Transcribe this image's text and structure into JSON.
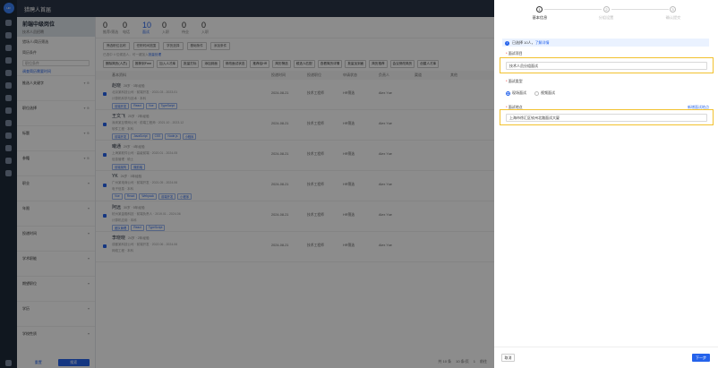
{
  "app": {
    "title": "猎聘人首届"
  },
  "sidebar": {
    "project_name": "前端中级岗位",
    "project_sub": "技术人员招聘",
    "header_label": "猎场人/简历筛选",
    "field1_label": "简历条件",
    "field1_value": "职位条件",
    "link1": "调查简历需要时间",
    "filters": [
      "推选人关键字",
      "职位选择",
      "标题",
      "参籍",
      "职业",
      "年限",
      "投递时间",
      "学术职能",
      "期望职位",
      "学历",
      "学校性质"
    ],
    "reset": "重置",
    "search": "搜索"
  },
  "stages": [
    {
      "num": "0",
      "label": "推荐/筛选"
    },
    {
      "num": "0",
      "label": "电话"
    },
    {
      "num": "10",
      "label": "面试"
    },
    {
      "num": "0",
      "label": "入职"
    },
    {
      "num": "0",
      "label": "待业"
    },
    {
      "num": "0",
      "label": "入职"
    }
  ],
  "filters": [
    "筛选职位名称",
    "任职时间范围",
    "学历选择",
    "基础条件",
    "添加条件"
  ],
  "info": {
    "text": "已选中 4 位候选人，可一键加入",
    "link": "批量处理"
  },
  "actions": [
    "删除简历(人员)",
    "推荐到Free",
    "加入人才库",
    "批量打标",
    "添加到面",
    "修改面试状态",
    "推荐给HR",
    "简历筛选",
    "候选人匹配",
    "查看简历详情",
    "批量加到面",
    "简历推荐",
    "会议修改简历",
    "创建人才库"
  ],
  "table_head": [
    "基本资料",
    "投递时间",
    "投递职位",
    "申请状态",
    "负责人",
    "渠道",
    "其他"
  ],
  "candidates": [
    {
      "name": "赵晓",
      "meta": "28岁 · 3年经验",
      "line1": "北京某科技公司 · 前端开发 · 2021.03 - 2023.01",
      "line2": "计算机科学与技术 · 本科",
      "tags": [
        "前端开发",
        "React",
        "Vue",
        "TypeScript"
      ],
      "date": "2024-08-21",
      "job": "技术工程师",
      "status": "HR筛选",
      "owner": "Alex Yue"
    },
    {
      "name": "王文飞",
      "meta": "25岁 · 2年经验",
      "line1": "深圳某互联网公司 · 前端工程师 · 2021.10 - 2023.12",
      "line2": "软件工程 · 本科",
      "tags": [
        "前端开发",
        "JavaScript",
        "CSS",
        "Node.js",
        "小程序"
      ],
      "date": "2024-08-21",
      "job": "技术工程师",
      "status": "HR筛选",
      "owner": "Alex Yue"
    },
    {
      "name": "曦通",
      "meta": "29岁 · 4年经验",
      "line1": "上海某软件公司 · 高级前端 · 2020.01 - 2024.05",
      "line2": "信息管理 · 硕士",
      "tags": [
        "前端架构",
        "微前端"
      ],
      "date": "2024-08-21",
      "job": "技术工程师",
      "status": "HR筛选",
      "owner": "Alex Yue"
    },
    {
      "name": "YK",
      "meta": "26岁 · 3年经验",
      "line1": "广州某电商公司 · 前端开发 · 2021.05 - 2024.06",
      "line2": "电子信息 · 本科",
      "tags": [
        "Vue",
        "React",
        "Webpack",
        "前端开发",
        "小程序"
      ],
      "date": "2024-08-21",
      "job": "技术工程师",
      "status": "HR筛选",
      "owner": "Alex Yue"
    },
    {
      "name": "阿远",
      "meta": "30岁 · 5年经验",
      "line1": "杭州某金融科技 · 前端负责人 · 2019.01 - 2024.06",
      "line2": "计算机应用 · 本科",
      "tags": [
        "团队管理",
        "React",
        "TypeScript"
      ],
      "date": "2024-08-21",
      "job": "技术工程师",
      "status": "HR筛选",
      "owner": "Alex Yue"
    },
    {
      "name": "李晓晓",
      "meta": "24岁 · 2年经验",
      "line1": "成都某科技公司 · 前端开发 · 2022.06 - 2024.06",
      "line2": "网络工程 · 本科",
      "tags": [],
      "date": "2024-08-21",
      "job": "技术工程师",
      "status": "HR筛选",
      "owner": "Alex Yue"
    }
  ],
  "pager": {
    "total": "共 10 条",
    "size": "10 条/页",
    "page": "1",
    "goto": "前往"
  },
  "drawer": {
    "steps": [
      "基本信息",
      "分组设置",
      "确认提交"
    ],
    "notice_text": "已选择 10人，",
    "notice_link": "了解详情",
    "field1_label": "面试项目",
    "field1_value": "技术人员分组面试",
    "field2_label": "面试类型",
    "radio1": "现场面试",
    "radio2": "视频面试",
    "field3_label": "面试地点",
    "field3_value": "上海市徐汇区钦州北路面试大厦",
    "new_location": "新增面试地点",
    "cancel": "取消",
    "next": "下一步",
    "required_mark": "*"
  }
}
